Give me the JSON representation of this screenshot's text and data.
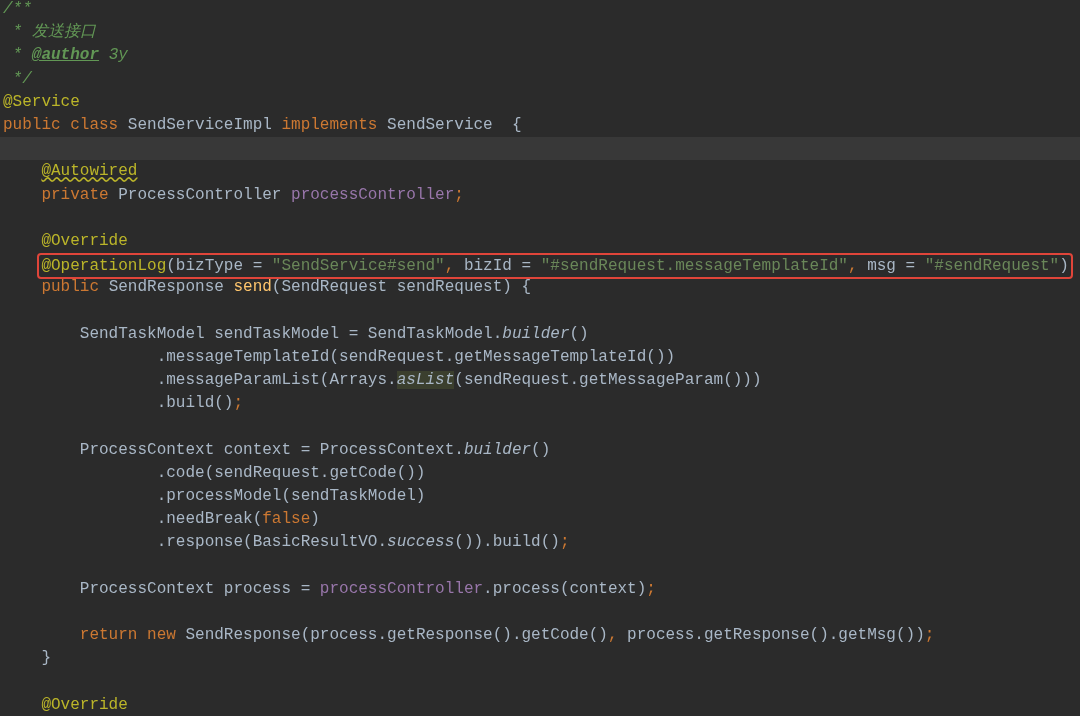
{
  "editor": {
    "lines": [
      {
        "current": false,
        "boxed": false,
        "tokens": [
          {
            "text": "/**",
            "kind": "comment"
          }
        ]
      },
      {
        "current": false,
        "boxed": false,
        "tokens": [
          {
            "text": " * 发送接口",
            "kind": "comment"
          }
        ]
      },
      {
        "current": false,
        "boxed": false,
        "tokens": [
          {
            "text": " * ",
            "kind": "comment"
          },
          {
            "text": "@author",
            "kind": "doctag"
          },
          {
            "text": " 3y",
            "kind": "comment"
          }
        ]
      },
      {
        "current": false,
        "boxed": false,
        "tokens": [
          {
            "text": " */",
            "kind": "comment"
          }
        ]
      },
      {
        "current": false,
        "boxed": false,
        "tokens": [
          {
            "text": "@Service",
            "kind": "annotation"
          }
        ]
      },
      {
        "current": false,
        "boxed": false,
        "tokens": [
          {
            "text": "public class ",
            "kind": "keyword"
          },
          {
            "text": "SendServiceImpl ",
            "kind": "plain"
          },
          {
            "text": "implements ",
            "kind": "keyword"
          },
          {
            "text": "SendService  {",
            "kind": "plain"
          }
        ]
      },
      {
        "current": true,
        "boxed": false
      },
      {
        "current": false,
        "boxed": false,
        "tokens": [
          {
            "text": "    @Autowired",
            "kind": "warning"
          }
        ]
      },
      {
        "current": false,
        "boxed": false,
        "tokens": [
          {
            "text": "    private ",
            "kind": "keyword"
          },
          {
            "text": "ProcessController ",
            "kind": "plain"
          },
          {
            "text": "processController",
            "kind": "field"
          },
          {
            "text": ";",
            "kind": "keyword"
          }
        ]
      },
      {
        "current": false,
        "boxed": false
      },
      {
        "current": false,
        "boxed": false,
        "tokens": [
          {
            "text": "    @Override",
            "kind": "annotation"
          }
        ]
      },
      {
        "current": false,
        "boxed": true,
        "tokens": [
          {
            "text": "    @OperationLog",
            "kind": "annotation"
          },
          {
            "text": "(bizType = ",
            "kind": "plain"
          },
          {
            "text": "\"SendService#send\"",
            "kind": "string"
          },
          {
            "text": ", ",
            "kind": "keyword"
          },
          {
            "text": "bizId = ",
            "kind": "plain"
          },
          {
            "text": "\"#sendRequest.messageTemplateId\"",
            "kind": "string"
          },
          {
            "text": ", ",
            "kind": "keyword"
          },
          {
            "text": "msg = ",
            "kind": "plain"
          },
          {
            "text": "\"#sendRequest\"",
            "kind": "string"
          },
          {
            "text": ")",
            "kind": "plain"
          }
        ]
      },
      {
        "current": false,
        "boxed": false,
        "tokens": [
          {
            "text": "    public ",
            "kind": "keyword"
          },
          {
            "text": "SendResponse ",
            "kind": "plain"
          },
          {
            "text": "send",
            "kind": "method"
          },
          {
            "text": "(SendRequest sendRequest) {",
            "kind": "plain"
          }
        ]
      },
      {
        "current": false,
        "boxed": false
      },
      {
        "current": false,
        "boxed": false,
        "tokens": [
          {
            "text": "        SendTaskModel sendTaskModel = SendTaskModel.",
            "kind": "plain"
          },
          {
            "text": "builder",
            "kind": "static"
          },
          {
            "text": "()",
            "kind": "plain"
          }
        ]
      },
      {
        "current": false,
        "boxed": false,
        "tokens": [
          {
            "text": "                .messageTemplateId(sendRequest.getMessageTemplateId())",
            "kind": "plain"
          }
        ]
      },
      {
        "current": false,
        "boxed": false,
        "tokens": [
          {
            "text": "                .messageParamList(Arrays.",
            "kind": "plain"
          },
          {
            "text": "asList",
            "kind": "usage"
          },
          {
            "text": "(sendRequest.getMessageParam()))",
            "kind": "plain"
          }
        ]
      },
      {
        "current": false,
        "boxed": false,
        "tokens": [
          {
            "text": "                .build()",
            "kind": "plain"
          },
          {
            "text": ";",
            "kind": "keyword"
          }
        ]
      },
      {
        "current": false,
        "boxed": false
      },
      {
        "current": false,
        "boxed": false,
        "tokens": [
          {
            "text": "        ProcessContext context = ProcessContext.",
            "kind": "plain"
          },
          {
            "text": "builder",
            "kind": "static"
          },
          {
            "text": "()",
            "kind": "plain"
          }
        ]
      },
      {
        "current": false,
        "boxed": false,
        "tokens": [
          {
            "text": "                .code(sendRequest.getCode())",
            "kind": "plain"
          }
        ]
      },
      {
        "current": false,
        "boxed": false,
        "tokens": [
          {
            "text": "                .processModel(sendTaskModel)",
            "kind": "plain"
          }
        ]
      },
      {
        "current": false,
        "boxed": false,
        "tokens": [
          {
            "text": "                .needBreak(",
            "kind": "plain"
          },
          {
            "text": "false",
            "kind": "keyword"
          },
          {
            "text": ")",
            "kind": "plain"
          }
        ]
      },
      {
        "current": false,
        "boxed": false,
        "tokens": [
          {
            "text": "                .response(BasicResultVO.",
            "kind": "plain"
          },
          {
            "text": "success",
            "kind": "static"
          },
          {
            "text": "()).build()",
            "kind": "plain"
          },
          {
            "text": ";",
            "kind": "keyword"
          }
        ]
      },
      {
        "current": false,
        "boxed": false
      },
      {
        "current": false,
        "boxed": false,
        "tokens": [
          {
            "text": "        ProcessContext process = ",
            "kind": "plain"
          },
          {
            "text": "processController",
            "kind": "field"
          },
          {
            "text": ".process(context)",
            "kind": "plain"
          },
          {
            "text": ";",
            "kind": "keyword"
          }
        ]
      },
      {
        "current": false,
        "boxed": false
      },
      {
        "current": false,
        "boxed": false,
        "tokens": [
          {
            "text": "        return new ",
            "kind": "keyword"
          },
          {
            "text": "SendResponse(process.getResponse().getCode()",
            "kind": "plain"
          },
          {
            "text": ", ",
            "kind": "keyword"
          },
          {
            "text": "process.getResponse().getMsg())",
            "kind": "plain"
          },
          {
            "text": ";",
            "kind": "keyword"
          }
        ]
      },
      {
        "current": false,
        "boxed": false,
        "tokens": [
          {
            "text": "    }",
            "kind": "plain"
          }
        ]
      },
      {
        "current": false,
        "boxed": false
      },
      {
        "current": false,
        "boxed": false,
        "tokens": [
          {
            "text": "    @Override",
            "kind": "annotation"
          }
        ]
      }
    ]
  }
}
